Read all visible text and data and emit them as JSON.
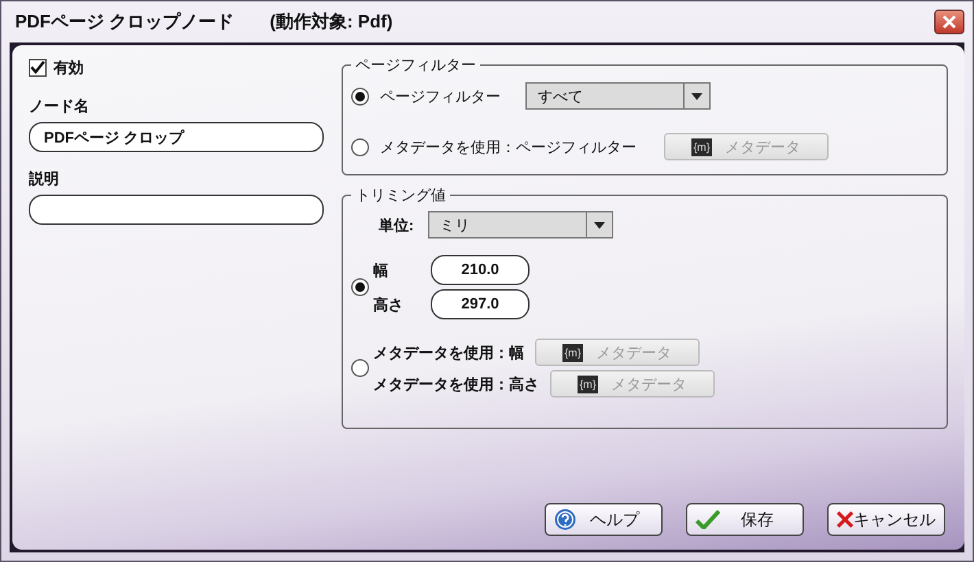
{
  "window": {
    "title": "PDFページ クロップノード",
    "target": "(動作対象: Pdf)"
  },
  "enabled": {
    "label": "有効",
    "checked": true
  },
  "node_name": {
    "label": "ノード名",
    "value": "PDFページ クロップ"
  },
  "description": {
    "label": "説明"
  },
  "page_filter": {
    "title": "ページフィルター",
    "options": [
      {
        "kind": "dropdown",
        "label": "ページフィルター",
        "selected": true,
        "value": "すべて"
      },
      {
        "kind": "metadata",
        "label": "メタデータを使用：ページフィルター",
        "selected": false,
        "button": {
          "badge": "{m}",
          "label": "メタデータ",
          "disabled": true
        }
      }
    ]
  },
  "trimming": {
    "title": "トリミング値",
    "unit": {
      "label": "単位:",
      "value": "ミリ"
    },
    "options": [
      {
        "kind": "values",
        "selected": true,
        "fields": [
          {
            "label": "幅",
            "value": "210.0"
          },
          {
            "label": "高さ",
            "value": "297.0"
          }
        ]
      },
      {
        "kind": "metadata",
        "selected": false,
        "fields": [
          {
            "label": "メタデータを使用：幅",
            "button": {
              "badge": "{m}",
              "label": "メタデータ",
              "disabled": true
            }
          },
          {
            "label": "メタデータを使用：高さ",
            "button": {
              "badge": "{m}",
              "label": "メタデータ",
              "disabled": true
            }
          }
        ]
      }
    ]
  },
  "buttons": [
    {
      "kind": "help",
      "label": "ヘルプ"
    },
    {
      "kind": "save",
      "label": "保存"
    },
    {
      "kind": "cancel",
      "label": "キャンセル"
    }
  ]
}
